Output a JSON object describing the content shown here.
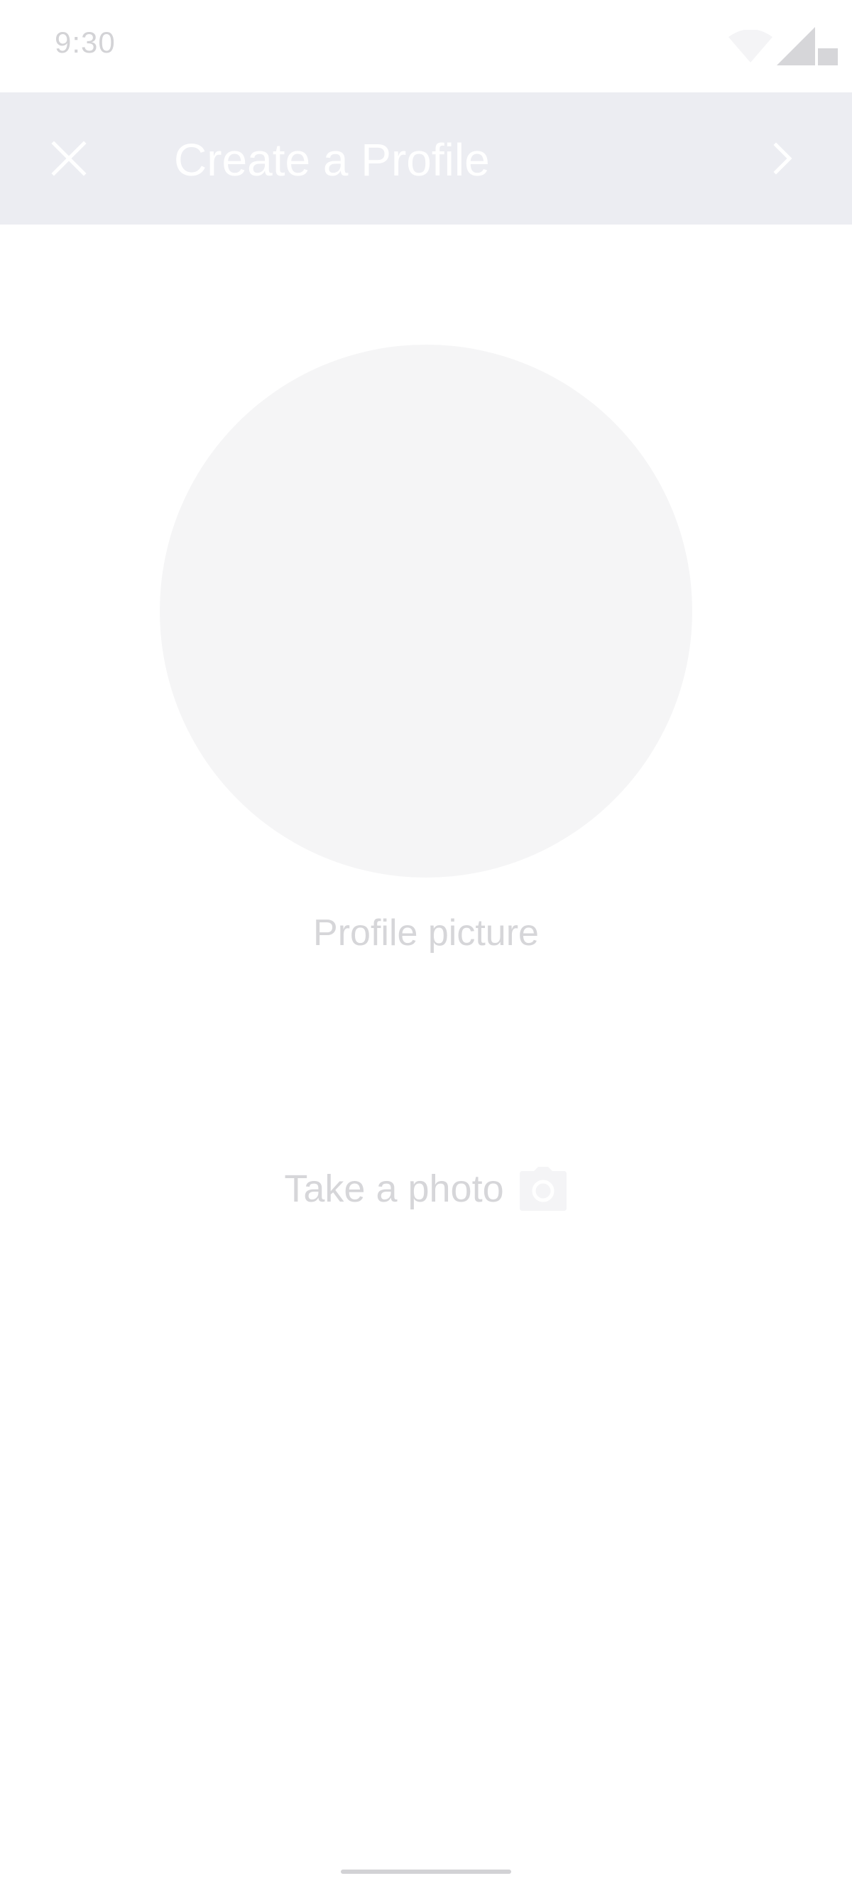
{
  "status_bar": {
    "time": "9:30",
    "icons": [
      "wifi-icon",
      "cell-signal-icon",
      "battery-icon"
    ]
  },
  "app_bar": {
    "close_icon": "close-icon",
    "title": "Create a Profile",
    "next_icon": "chevron-right-icon",
    "background_color": "#ecedf2"
  },
  "profile": {
    "picture_caption": "Profile picture"
  },
  "actions": {
    "take_photo_label": "Take a photo",
    "camera_icon": "camera-icon"
  }
}
